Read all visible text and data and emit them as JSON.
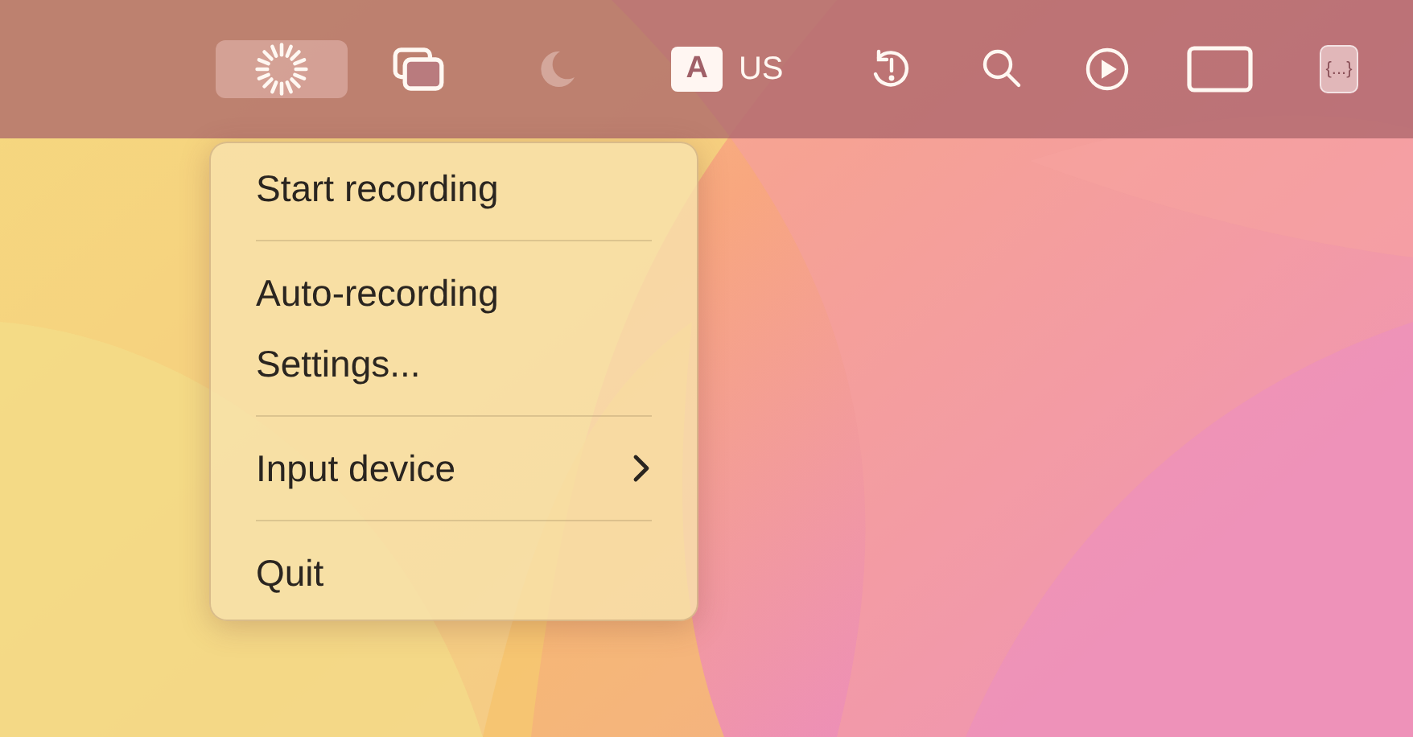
{
  "menu_bar": {
    "items": [
      {
        "kind": "icon",
        "selected": true,
        "disabled": false
      },
      {
        "kind": "icon",
        "selected": false,
        "disabled": false
      },
      {
        "kind": "icon",
        "selected": false,
        "disabled": true
      },
      {
        "kind": "input_source",
        "badge": "A",
        "label": "US",
        "selected": false,
        "disabled": false
      },
      {
        "kind": "icon",
        "selected": false,
        "disabled": false
      },
      {
        "kind": "icon",
        "selected": false,
        "disabled": false
      },
      {
        "kind": "icon",
        "selected": false,
        "disabled": false
      },
      {
        "kind": "icon",
        "selected": false,
        "disabled": false
      },
      {
        "kind": "key",
        "label": "{...}",
        "selected": false,
        "disabled": false
      }
    ]
  },
  "menu": {
    "items": [
      {
        "kind": "item",
        "label": "Start recording",
        "submenu": false
      },
      {
        "kind": "separator"
      },
      {
        "kind": "item",
        "label": "Auto-recording",
        "submenu": false
      },
      {
        "kind": "item",
        "label": "Settings...",
        "submenu": false
      },
      {
        "kind": "separator"
      },
      {
        "kind": "item",
        "label": "Input device",
        "submenu": true
      },
      {
        "kind": "separator"
      },
      {
        "kind": "item",
        "label": "Quit",
        "submenu": false
      }
    ]
  }
}
